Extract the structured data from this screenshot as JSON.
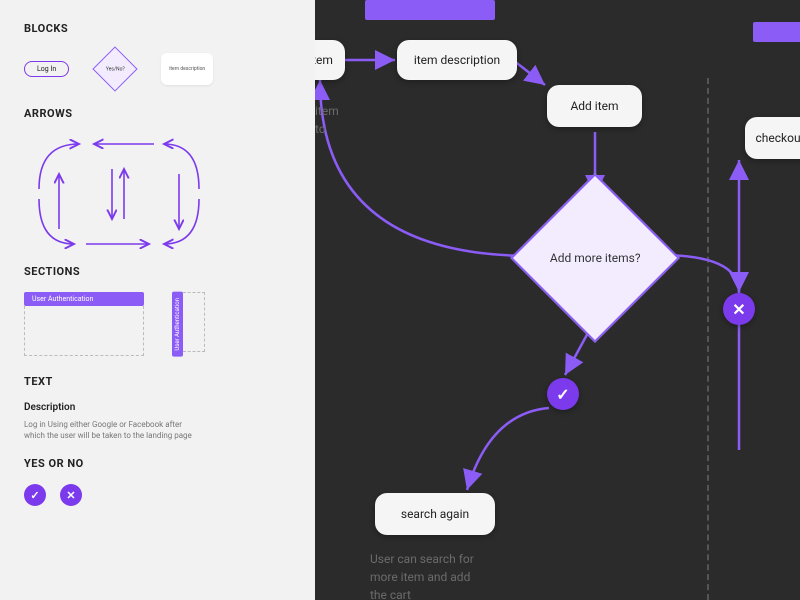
{
  "sidebar": {
    "blocks": {
      "title": "BLOCKS",
      "login": "Log In",
      "decision": "Yes/No?",
      "card": "item description"
    },
    "arrows": {
      "title": "ARROWS"
    },
    "sections": {
      "title": "SECTIONS",
      "h_label": "User Authentication",
      "v_label": "User Authentication"
    },
    "text": {
      "title": "TEXT",
      "subtitle": "Description",
      "body": "Log in Using either Google or Facebook after which the user will be taken to the landing page"
    },
    "yesno": {
      "title": "YES OR NO",
      "yes": "✓",
      "no": "✕"
    }
  },
  "canvas": {
    "nodes": {
      "peek": "r item",
      "itemdesc": "item description",
      "additem": "Add item",
      "checkout": "checkout",
      "decision": "Add more items?",
      "searchagain": "search again"
    },
    "circles": {
      "yes": "✓",
      "no": "✕"
    },
    "ghost1_a": "item",
    "ghost1_b": "to",
    "ghost2_a": "User can search for",
    "ghost2_b": "more item and add",
    "ghost2_c": "the cart"
  }
}
